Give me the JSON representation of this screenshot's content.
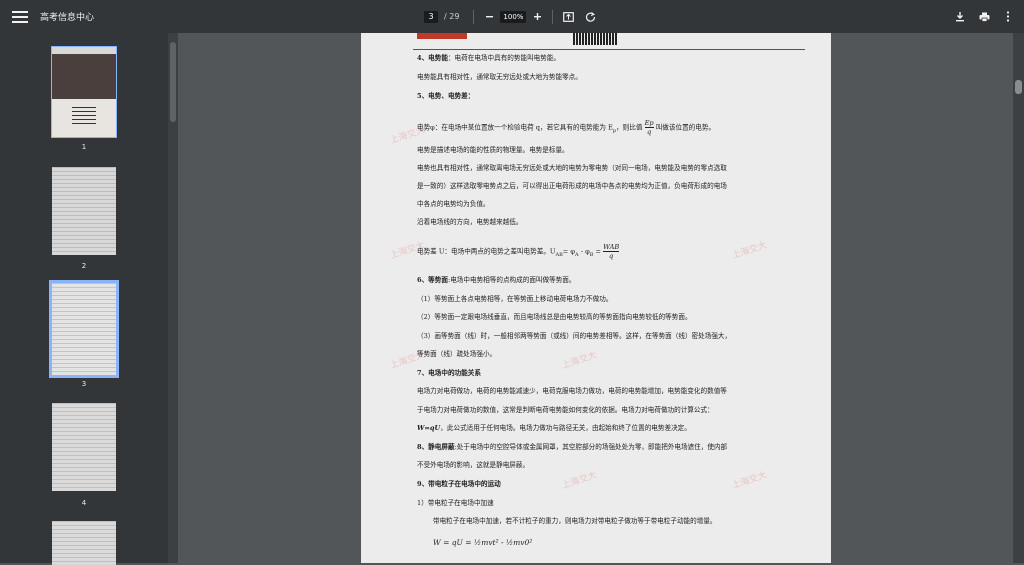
{
  "app": {
    "title": "高考信息中心"
  },
  "toolbar": {
    "current_page": "3",
    "page_separator": "/ 29",
    "zoom": "100%"
  },
  "thumbnails": [
    {
      "num": "1"
    },
    {
      "num": "2"
    },
    {
      "num": "3"
    },
    {
      "num": "4"
    }
  ],
  "doc": {
    "h4": "4、电势能",
    "h4_rest": "：电荷在电场中具有的势能叫电势能。",
    "l1": "电势能具有相对性，通常取无穷远处或大地为势能零点。",
    "h5": "5、电势、电势差：",
    "l2a": "电势φ：在电场中某位置放一个检验电荷 q，若它具有的电势能为 E",
    "l2b": "，则比值",
    "l2c": "叫做该位置的电势。",
    "frac_ep_top": "Ep",
    "frac_ep_bot": "q",
    "l3": "电势是描述电场的能的性质的物理量。电势是标量。",
    "l4": "电势也具有相对性，通常取离电场无穷远处或大地的电势为零电势（对同一电场，电势能及电势的零点选取",
    "l5": "是一致的）这样选取零电势点之后，可以得出正电荷形成的电场中各点的电势均为正值，负电荷形成的电场",
    "l6": "中各点的电势均为负值。",
    "l7": "沿着电场线的方向，电势越来越低。",
    "l8a": "电势差 U：电场中两点的电势之差叫电势差。U",
    "l8b": "= φ",
    "l8c": " - φ",
    "l8d": " =",
    "frac_w_top": "WAB",
    "frac_w_bot": "q",
    "h6": "6、等势面",
    "h6_rest": ":电场中电势相等的点构成的面叫做等势面。",
    "l9": "（1）等势面上各点电势相等，在等势面上移动电荷电场力不做功。",
    "l10": "（2）等势面一定跟电场线垂直，而且电场线总是由电势较高的等势面指向电势较低的等势面。",
    "l11": "（3）画等势面（线）时，一般相邻两等势面（或线）间的电势差相等。这样，在等势面（线）密处场强大，",
    "l12": "等势面（线）疏处场强小。",
    "h7": "7、电场中的功能关系",
    "l13": "电场力对电荷做功，电荷的电势能减速少，电荷克服电场力做功，电荷的电势能增加，电势能变化的数值等",
    "l14": "于电场力对电荷做功的数值，这常是判断电荷电势能如何变化的依据。电场力对电荷做功的计算公式：",
    "l15a": "W=qU",
    "l15b": "，此公式适用于任何电场。电场力做功与路径无关，由起始和终了位置的电势差决定。",
    "h8": "8、静电屏蔽",
    "h8_rest": ":处于电场中的空腔导体或金属网罩，其空腔部分的场强处处为零，即能把外电场遮住，使内部",
    "l16": "不受外电场的影响，这就是静电屏蔽。",
    "h9": "9、带电粒子在电场中的运动",
    "l17": "1）带电粒子在电场中加速",
    "l18": "带电粒子在电场中加速，若不计粒子的重力，则电场力对带电粒子做功等于带电粒子动能的增量。",
    "l19": "W = qU = ½mvt² - ½mv0²",
    "watermark": "上海交大"
  },
  "colors": {
    "toolbar": "#323639",
    "viewer_bg": "#525659",
    "select": "#8ab4f8"
  }
}
